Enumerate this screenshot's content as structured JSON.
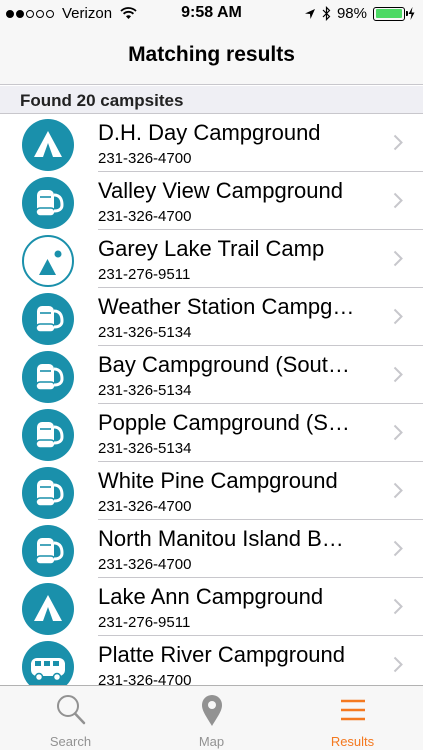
{
  "status_bar": {
    "carrier": "Verizon",
    "signal_bars_filled": 2,
    "signal_bars_total": 5,
    "time": "9:58 AM",
    "battery_percent": "98%",
    "battery_level": 0.98
  },
  "nav": {
    "title": "Matching results"
  },
  "section": {
    "header": "Found 20 campsites"
  },
  "colors": {
    "icon_teal": "#1a90ab",
    "active_tab": "#f47920",
    "inactive_tab": "#929292"
  },
  "results": [
    {
      "name": "D.H. Day Campground",
      "phone": "231-326-4700",
      "icon": "tent-icon"
    },
    {
      "name": "Valley View Campground",
      "phone": "231-326-4700",
      "icon": "backpack-icon"
    },
    {
      "name": "Garey Lake Trail Camp",
      "phone": "231-276-9511",
      "icon": "trail-camp-icon"
    },
    {
      "name": "Weather Station Campg…",
      "phone": "231-326-5134",
      "icon": "backpack-icon"
    },
    {
      "name": "Bay Campground (Sout…",
      "phone": "231-326-5134",
      "icon": "backpack-icon"
    },
    {
      "name": "Popple Campground (S…",
      "phone": "231-326-5134",
      "icon": "backpack-icon"
    },
    {
      "name": "White Pine Campground",
      "phone": "231-326-4700",
      "icon": "backpack-icon"
    },
    {
      "name": "North Manitou Island B…",
      "phone": "231-326-4700",
      "icon": "backpack-icon"
    },
    {
      "name": "Lake Ann Campground",
      "phone": "231-276-9511",
      "icon": "tent-icon"
    },
    {
      "name": "Platte River Campground",
      "phone": "231-326-4700",
      "icon": "rv-icon"
    }
  ],
  "tabs": [
    {
      "label": "Search",
      "icon": "search-icon",
      "active": false
    },
    {
      "label": "Map",
      "icon": "map-pin-icon",
      "active": false
    },
    {
      "label": "Results",
      "icon": "list-icon",
      "active": true
    }
  ]
}
